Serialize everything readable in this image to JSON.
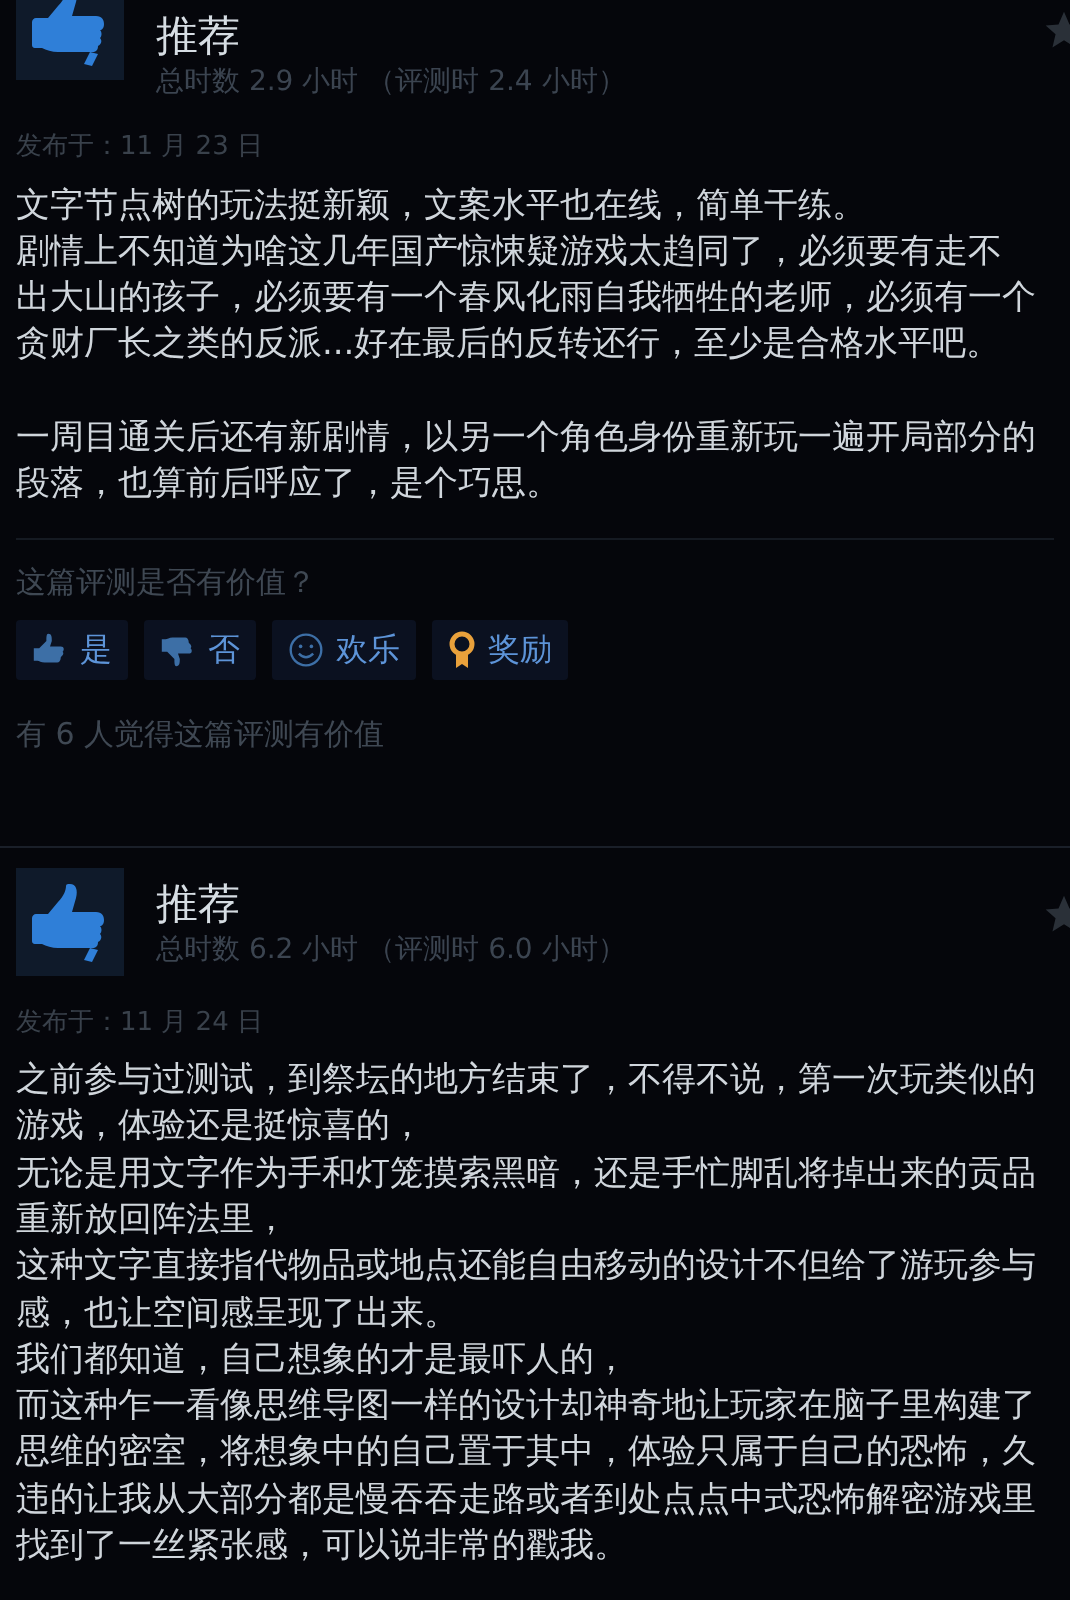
{
  "reviews": [
    {
      "verdict": "推荐",
      "hours": "总时数 2.9 小时 （评测时 2.4 小时）",
      "date": "发布于：11 月 23 日",
      "paragraphs": [
        [
          "文字节点树的玩法挺新颖，文案水平也在线，简单干练。",
          "剧情上不知道为啥这几年国产惊悚疑游戏太趋同了，必须要有走不",
          "出大山的孩子，必须要有一个春风化雨自我牺牲的老师，必须有一个",
          "贪财厂长之类的反派...好在最后的反转还行，至少是合格水平吧。"
        ],
        [
          "一周目通关后还有新剧情，以另一个角色身份重新玩一遍开局部分的",
          "段落，也算前后呼应了，是个巧思。"
        ]
      ],
      "helpful_question": "这篇评测是否有价值？",
      "actions": [
        {
          "kind": "yes",
          "label": "是"
        },
        {
          "kind": "no",
          "label": "否"
        },
        {
          "kind": "funny",
          "label": "欢乐"
        },
        {
          "kind": "award",
          "label": "奖励"
        }
      ],
      "helpful_count": "有 6 人觉得这篇评测有价值"
    },
    {
      "verdict": "推荐",
      "hours": "总时数 6.2 小时 （评测时 6.0 小时）",
      "date": "发布于：11 月 24 日",
      "paragraphs": [
        [
          "之前参与过测试，到祭坛的地方结束了，不得不说，第一次玩类似的",
          "游戏，体验还是挺惊喜的，",
          "无论是用文字作为手和灯笼摸索黑暗，还是手忙脚乱将掉出来的贡品",
          "重新放回阵法里，",
          "这种文字直接指代物品或地点还能自由移动的设计不但给了游玩参与",
          "感，也让空间感呈现了出来。",
          "我们都知道，自己想象的才是最吓人的，",
          "而这种乍一看像思维导图一样的设计却神奇地让玩家在脑子里构建了",
          "思维的密室，将想象中的自己置于其中，体验只属于自己的恐怖，久",
          "违的让我从大部分都是慢吞吞走路或者到处点点中式恐怖解密游戏里",
          "找到了一丝紧张感，可以说非常的戳我。"
        ]
      ]
    }
  ]
}
